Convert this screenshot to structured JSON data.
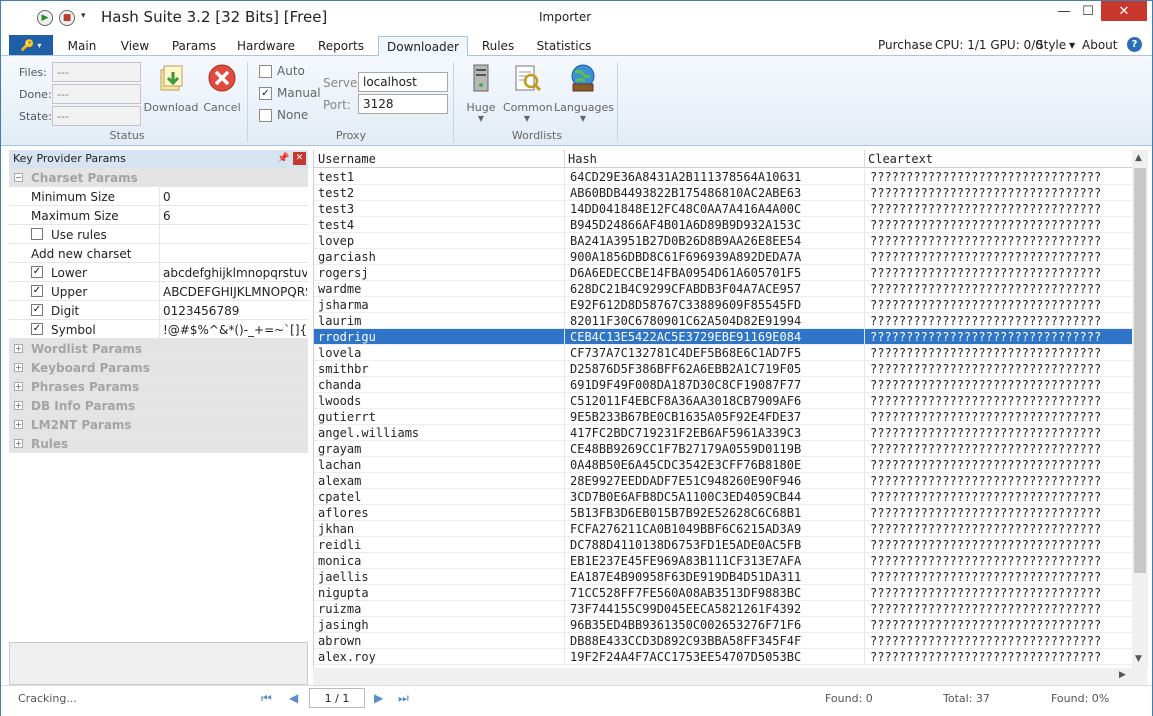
{
  "title_bar": {
    "app_title": "Hash Suite 3.2 [32 Bits] [Free]",
    "context": "Importer",
    "minimize": "—",
    "maximize": "☐",
    "close": "✕"
  },
  "tabs": [
    {
      "label": "Main"
    },
    {
      "label": "View"
    },
    {
      "label": "Params"
    },
    {
      "label": "Hardware"
    },
    {
      "label": "Reports"
    },
    {
      "label": "Downloader"
    },
    {
      "label": "Rules"
    },
    {
      "label": "Statistics"
    }
  ],
  "active_tab": "Downloader",
  "right_menu": {
    "purchase": "Purchase",
    "cpu_gpu": "CPU: 1/1 GPU: 0/0",
    "style": "Style",
    "about": "About",
    "help": "?"
  },
  "ribbon": {
    "status": {
      "files_label": "Files:",
      "files_value": "---",
      "done_label": "Done:",
      "done_value": "---",
      "state_label": "State:",
      "state_value": "---",
      "download_label": "Download",
      "cancel_label": "Cancel",
      "group_title": "Status"
    },
    "proxy": {
      "auto_label": "Auto",
      "manual_label": "Manual",
      "none_label": "None",
      "selected": "Manual",
      "server_label": "Server:",
      "server_value": "localhost",
      "port_label": "Port:",
      "port_value": "3128",
      "group_title": "Proxy"
    },
    "wordlists": {
      "huge_label": "Huge",
      "common_label": "Common",
      "languages_label": "Languages",
      "group_title": "Wordlists"
    }
  },
  "left_panel": {
    "title": "Key Provider Params",
    "charset_params": "Charset Params",
    "rows": [
      {
        "name": "Minimum Size",
        "value": "0"
      },
      {
        "name": "Maximum Size",
        "value": "6"
      },
      {
        "name": "Use rules",
        "value": "",
        "checked": false
      },
      {
        "name": "Add new charset",
        "value": ""
      },
      {
        "name": "Lower",
        "value": "abcdefghijklmnopqrstuvwxyz",
        "checked": true
      },
      {
        "name": "Upper",
        "value": "ABCDEFGHIJKLMNOPQRSTUVWXYZ",
        "checked": true
      },
      {
        "name": "Digit",
        "value": "0123456789",
        "checked": true
      },
      {
        "name": "Symbol",
        "value": " !@#$%^&*()-_+=~`[]{}|:;",
        "checked": true
      }
    ],
    "categories": [
      "Wordlist Params",
      "Keyboard Params",
      "Phrases Params",
      "DB Info Params",
      "LM2NT Params",
      "Rules"
    ]
  },
  "grid": {
    "columns": [
      "Username",
      "Hash",
      "Cleartext"
    ],
    "selected_index": 10,
    "rows": [
      {
        "username": "test1",
        "hash": "64CD29E36A8431A2B111378564A10631",
        "clear": "????????????????????????????????"
      },
      {
        "username": "test2",
        "hash": "AB60BDB4493822B175486810AC2ABE63",
        "clear": "????????????????????????????????"
      },
      {
        "username": "test3",
        "hash": "14DD041848E12FC48C0AA7A416A4A00C",
        "clear": "????????????????????????????????"
      },
      {
        "username": "test4",
        "hash": "B945D24866AF4B01A6D89B9D932A153C",
        "clear": "????????????????????????????????"
      },
      {
        "username": "lovep",
        "hash": "BA241A3951B27D0B26D8B9AA26E8EE54",
        "clear": "????????????????????????????????"
      },
      {
        "username": "garciash",
        "hash": "900A1856DBD8C61F696939A892DEDA7A",
        "clear": "????????????????????????????????"
      },
      {
        "username": "rogersj",
        "hash": "D6A6EDECCBE14FBA0954D61A605701F5",
        "clear": "????????????????????????????????"
      },
      {
        "username": "wardme",
        "hash": "628DC21B4C9299CFABDB3F04A7ACE957",
        "clear": "????????????????????????????????"
      },
      {
        "username": "jsharma",
        "hash": "E92F612D8D58767C33889609F85545FD",
        "clear": "????????????????????????????????"
      },
      {
        "username": "laurim",
        "hash": "82011F30C6780901C62A504D82E91994",
        "clear": "????????????????????????????????"
      },
      {
        "username": "rrodrigu",
        "hash": "CEB4C13E5422AC5E3729EBE91169E084",
        "clear": "????????????????????????????????"
      },
      {
        "username": "lovela",
        "hash": "CF737A7C132781C4DEF5B68E6C1AD7F5",
        "clear": "????????????????????????????????"
      },
      {
        "username": "smithbr",
        "hash": "D25876D5F386BFF62A6EBB2A1C719F05",
        "clear": "????????????????????????????????"
      },
      {
        "username": "chanda",
        "hash": "691D9F49F008DA187D30C8CF19087F77",
        "clear": "????????????????????????????????"
      },
      {
        "username": "lwoods",
        "hash": "C512011F4EBCF8A36AA3018CB7909AF6",
        "clear": "????????????????????????????????"
      },
      {
        "username": "gutierrt",
        "hash": "9E5B233B67BE0CB1635A05F92E4FDE37",
        "clear": "????????????????????????????????"
      },
      {
        "username": "angel.williams",
        "hash": "417FC2BDC719231F2EB6AF5961A339C3",
        "clear": "????????????????????????????????"
      },
      {
        "username": "grayam",
        "hash": "CE48BB9269CC1F7B27179A0559D0119B",
        "clear": "????????????????????????????????"
      },
      {
        "username": "lachan",
        "hash": "0A48B50E6A45CDC3542E3CFF76B8180E",
        "clear": "????????????????????????????????"
      },
      {
        "username": "alexam",
        "hash": "28E9927EEDDADF7E51C948260E90F946",
        "clear": "????????????????????????????????"
      },
      {
        "username": "cpatel",
        "hash": "3CD7B0E6AFB8DC5A1100C3ED4059CB44",
        "clear": "????????????????????????????????"
      },
      {
        "username": "aflores",
        "hash": "5B13FB3D6EB015B7B92E52628C6C68B1",
        "clear": "????????????????????????????????"
      },
      {
        "username": "jkhan",
        "hash": "FCFA276211CA0B1049BBF6C6215AD3A9",
        "clear": "????????????????????????????????"
      },
      {
        "username": "reidli",
        "hash": "DC788D4110138D6753FD1E5ADE0AC5FB",
        "clear": "????????????????????????????????"
      },
      {
        "username": "monica",
        "hash": "EB1E237E45FE969A83B111CF313E7AFA",
        "clear": "????????????????????????????????"
      },
      {
        "username": "jaellis",
        "hash": "EA187E4B90958F63DE919DB4D51DA311",
        "clear": "????????????????????????????????"
      },
      {
        "username": "nigupta",
        "hash": "71CC528FF7FE560A08AB3513DF9883BC",
        "clear": "????????????????????????????????"
      },
      {
        "username": "ruizma",
        "hash": "73F744155C99D045EECA5821261F4392",
        "clear": "????????????????????????????????"
      },
      {
        "username": "jasingh",
        "hash": "96B35ED4BB9361350C002653276F71F6",
        "clear": "????????????????????????????????"
      },
      {
        "username": "abrown",
        "hash": "DB88E433CCD3D892C93BBA58FF345F4F",
        "clear": "????????????????????????????????"
      },
      {
        "username": "alex.roy",
        "hash": "19F2F24A4F7ACC1753EE54707D5053BC",
        "clear": "????????????????????????????????"
      }
    ]
  },
  "status_bar": {
    "state": "Cracking...",
    "page": "1 / 1",
    "found": "Found: 0",
    "total": "Total: 37",
    "found_pct": "Found: 0%"
  },
  "colors": {
    "accent": "#1f5fa8",
    "selection": "#2e74c9",
    "close": "#c7372c"
  }
}
